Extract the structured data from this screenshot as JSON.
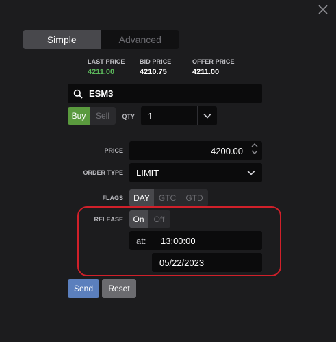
{
  "mode": {
    "simple_label": "Simple",
    "advanced_label": "Advanced"
  },
  "prices": {
    "last_label": "LAST PRICE",
    "last_value": "4211.00",
    "bid_label": "BID PRICE",
    "bid_value": "4210.75",
    "offer_label": "OFFER PRICE",
    "offer_value": "4211.00"
  },
  "symbol": {
    "value": "ESM3"
  },
  "side": {
    "buy_label": "Buy",
    "sell_label": "Sell",
    "selected": "Buy"
  },
  "qty": {
    "label": "QTY",
    "value": "1"
  },
  "price": {
    "label": "PRICE",
    "value": "4200.00"
  },
  "order_type": {
    "label": "ORDER TYPE",
    "value": "LIMIT"
  },
  "flags": {
    "label": "FLAGS",
    "options": [
      "DAY",
      "GTC",
      "GTD"
    ],
    "selected": "DAY"
  },
  "release": {
    "label": "RELEASE",
    "on_label": "On",
    "off_label": "Off",
    "selected": "On",
    "at_label": "at:",
    "time_value": "13:00:00",
    "date_value": "05/22/2023"
  },
  "actions": {
    "send_label": "Send",
    "reset_label": "Reset"
  },
  "colors": {
    "background": "#1c1c1e",
    "last_price_green": "#5cb85c",
    "buy_green": "#5a9a3e",
    "send_blue": "#5b7fbd",
    "reset_gray": "#6b6b6f",
    "highlight_red": "#d0202a"
  }
}
